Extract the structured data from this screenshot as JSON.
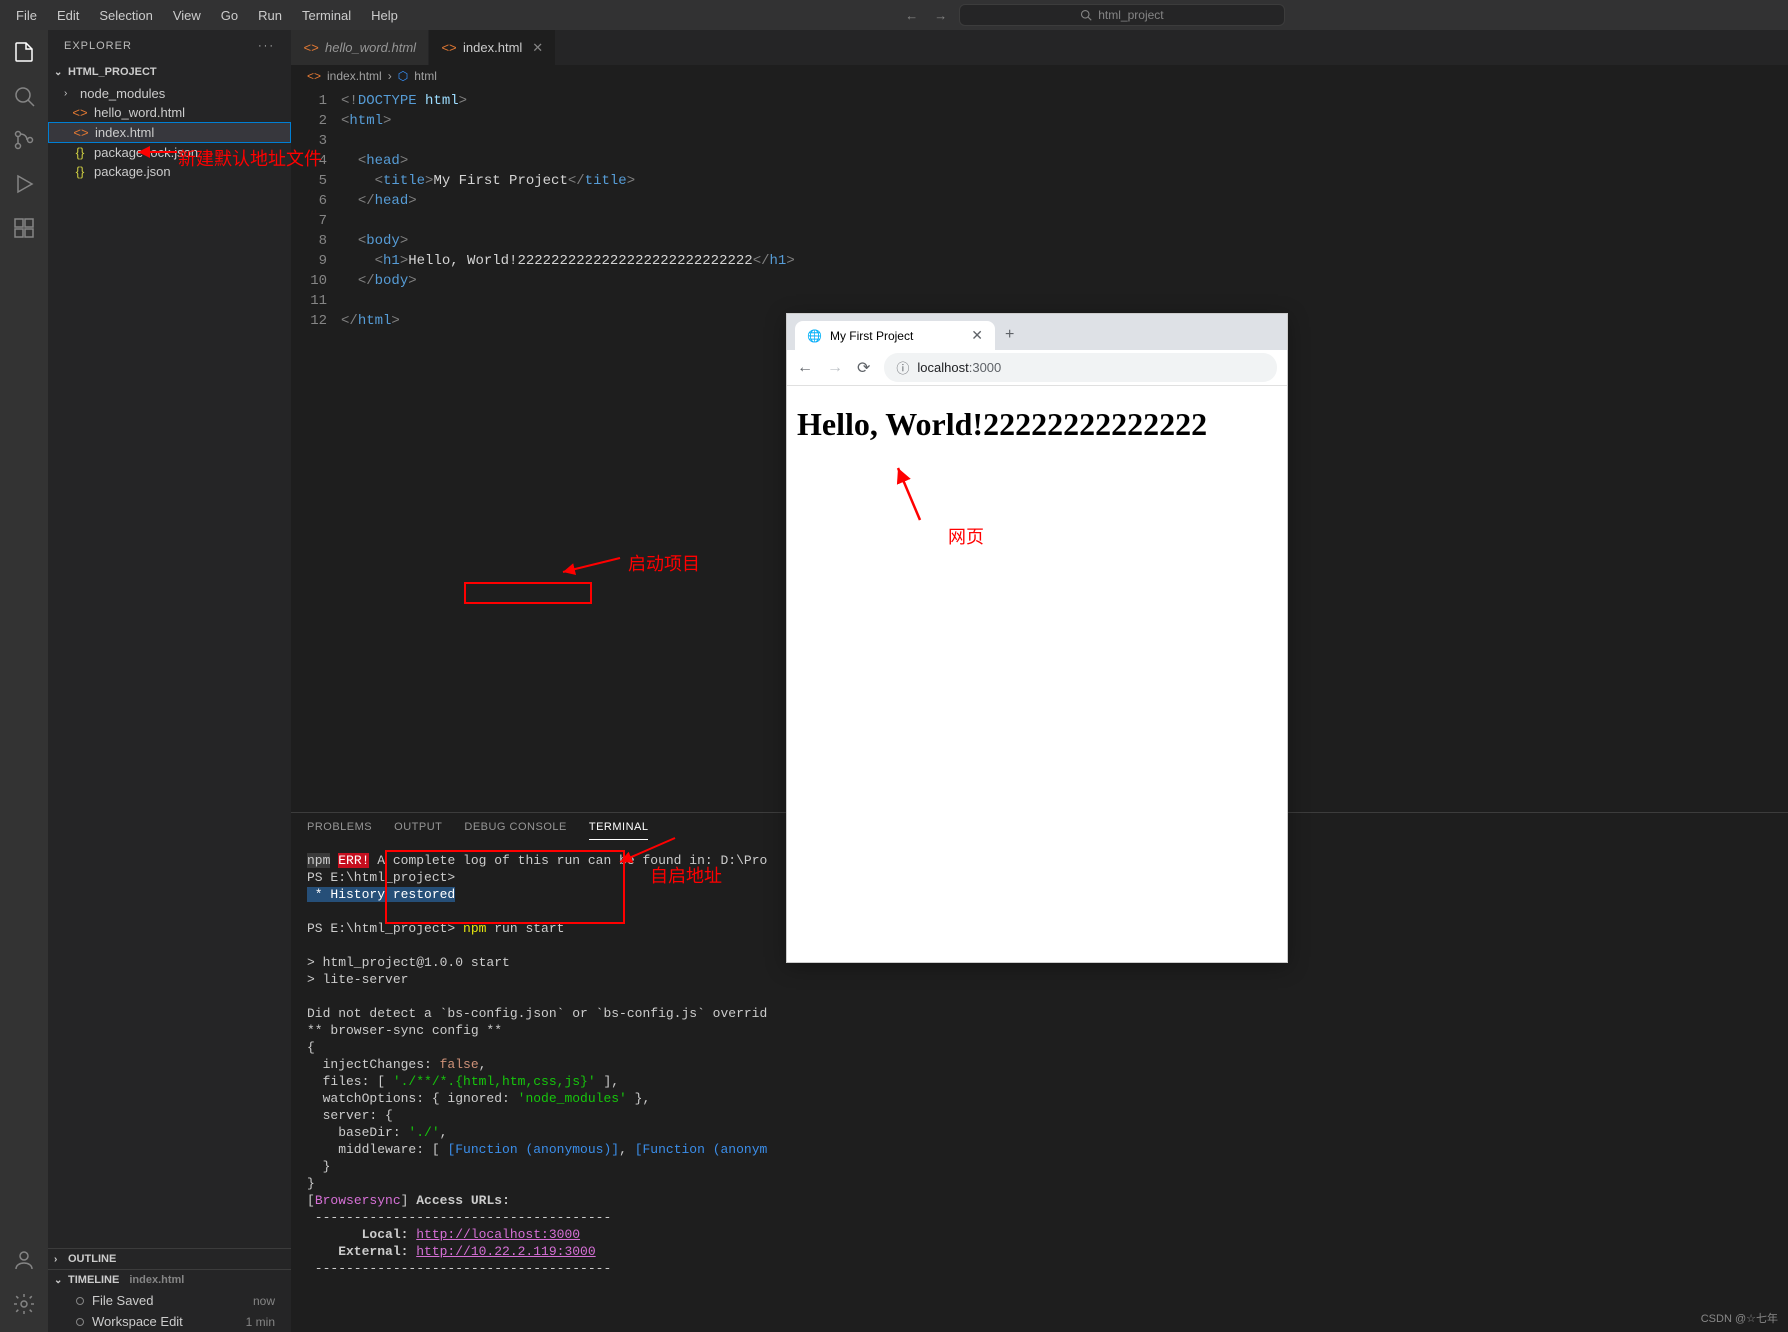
{
  "menubar": {
    "items": [
      "File",
      "Edit",
      "Selection",
      "View",
      "Go",
      "Run",
      "Terminal",
      "Help"
    ],
    "search_placeholder": "html_project"
  },
  "sidebar": {
    "title": "EXPLORER",
    "project": "HTML_PROJECT",
    "files": [
      {
        "name": "node_modules",
        "type": "folder"
      },
      {
        "name": "hello_word.html",
        "type": "html"
      },
      {
        "name": "index.html",
        "type": "html",
        "selected": true
      },
      {
        "name": "package-lock.json",
        "type": "json"
      },
      {
        "name": "package.json",
        "type": "json"
      }
    ],
    "outline": "OUTLINE",
    "timeline": {
      "label": "TIMELINE",
      "file": "index.html"
    },
    "timeline_items": [
      {
        "label": "File Saved",
        "time": "now"
      },
      {
        "label": "Workspace Edit",
        "time": "1 min"
      }
    ]
  },
  "tabs": [
    {
      "name": "hello_word.html",
      "active": false
    },
    {
      "name": "index.html",
      "active": true
    }
  ],
  "breadcrumb": {
    "file": "index.html",
    "symbol": "html"
  },
  "code": {
    "lines": [
      1,
      2,
      3,
      4,
      5,
      6,
      7,
      8,
      9,
      10,
      11,
      12
    ],
    "content": {
      "l1_doctype": "DOCTYPE",
      "l1_html": "html",
      "l2": "html",
      "l4": "head",
      "l5_title": "title",
      "l5_text": "My First Project",
      "l6": "head",
      "l8": "body",
      "l9_h1": "h1",
      "l9_text": "Hello, World!2222222222222222222222222222",
      "l10": "body",
      "l12": "html"
    }
  },
  "panel": {
    "tabs": [
      "PROBLEMS",
      "OUTPUT",
      "DEBUG CONSOLE",
      "TERMINAL"
    ],
    "active": "TERMINAL"
  },
  "terminal": {
    "l1_npm": "npm",
    "l1_err": "ERR!",
    "l1_rest": " A complete log of this run can be found in: D:\\Pro",
    "l2": "PS E:\\html_project>",
    "l3_star": " * ",
    "l3_hist": "History restored",
    "l4_ps": "PS E:\\html_project> ",
    "l4_npm": "npm",
    "l4_rest": " run start",
    "l5": "> html_project@1.0.0 start",
    "l6": "> lite-server",
    "l7": "Did not detect a `bs-config.json` or `bs-config.js` overrid",
    "l8": "** browser-sync config **",
    "l9": "{",
    "l10_a": "  injectChanges: ",
    "l10_b": "false",
    "l10_c": ",",
    "l11_a": "  files: [ ",
    "l11_b": "'./**/*.{html,htm,css,js}'",
    "l11_c": " ],",
    "l12_a": "  watchOptions: { ignored: ",
    "l12_b": "'node_modules'",
    "l12_c": " },",
    "l13": "  server: {",
    "l14_a": "    baseDir: ",
    "l14_b": "'./'",
    "l14_c": ",",
    "l15_a": "    middleware: [ ",
    "l15_b": "[Function (anonymous)]",
    "l15_c": ", ",
    "l15_d": "[Function (anonym",
    "l16": "  }",
    "l17": "}",
    "l18_a": "[",
    "l18_b": "Browsersync",
    "l18_c": "] ",
    "l18_d": "Access URLs:",
    "l19": " --------------------------------------",
    "l20_a": "       Local: ",
    "l20_b": "http://localhost:3000",
    "l21_a": "    External: ",
    "l21_b": "http://10.22.2.119:3000",
    "l22": " --------------------------------------"
  },
  "browser": {
    "tab_title": "My First Project",
    "url_host": "localhost",
    "url_port": ":3000",
    "heading": "Hello, World!22222222222222"
  },
  "annotations": {
    "new_file": "新建默认地址文件",
    "start_project": "启动项目",
    "self_addr": "自启地址",
    "webpage": "网页"
  },
  "watermark": "CSDN @☆七年"
}
